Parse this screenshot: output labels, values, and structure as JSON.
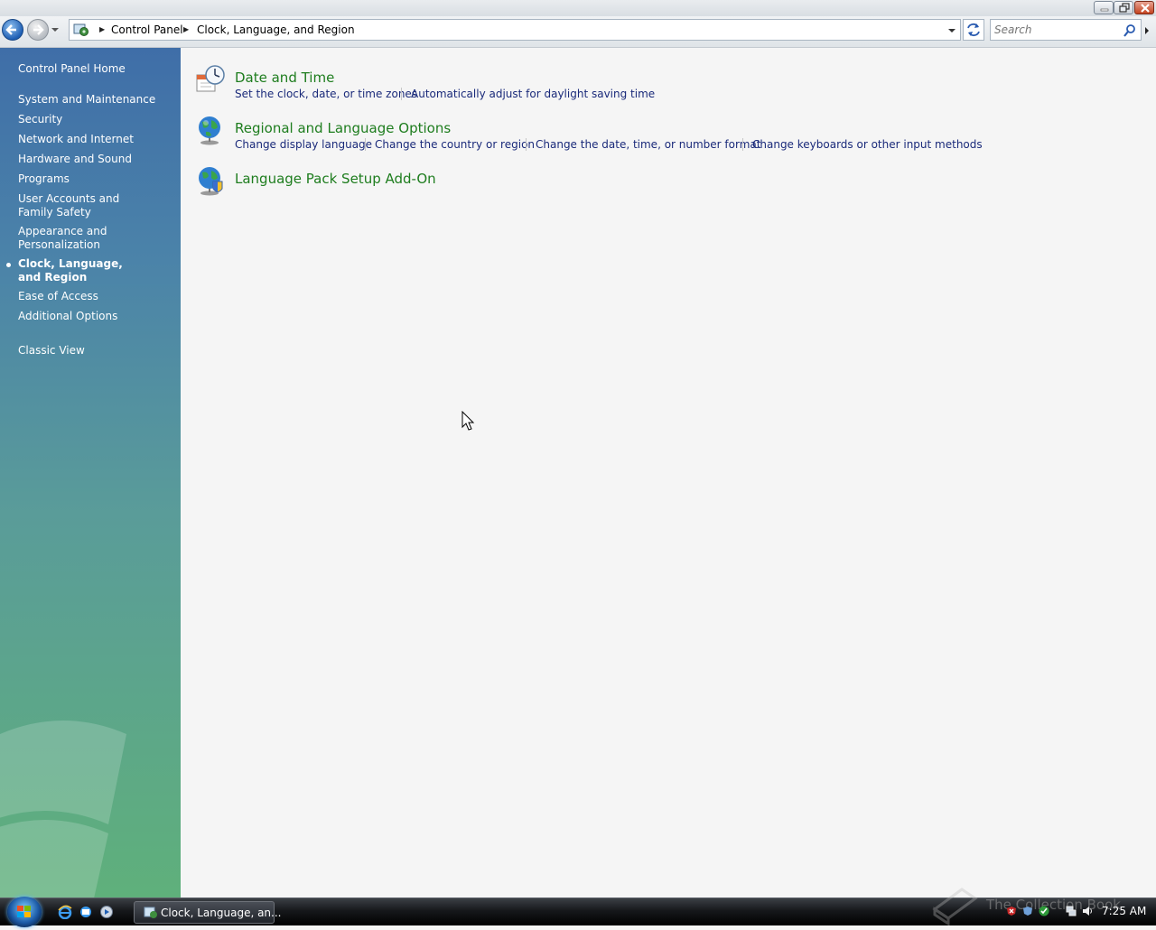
{
  "address_bar": {
    "crumbs": [
      "Control Panel",
      "Clock, Language, and Region"
    ]
  },
  "search": {
    "placeholder": "Search"
  },
  "sidebar": {
    "home": "Control Panel Home",
    "items": [
      "System and Maintenance",
      "Security",
      "Network and Internet",
      "Hardware and Sound",
      "Programs",
      "User Accounts and Family Safety",
      "Appearance and Personalization",
      "Clock, Language, and Region",
      "Ease of Access",
      "Additional Options"
    ],
    "current_item": "Clock, Language, and Region",
    "classic_view": "Classic View"
  },
  "categories": [
    {
      "title": "Date and Time",
      "icon": "clock-calendar-icon",
      "tasks": [
        "Set the clock, date, or time zones",
        "Automatically adjust for daylight saving time"
      ]
    },
    {
      "title": "Regional and Language Options",
      "icon": "globe-icon",
      "tasks": [
        "Change display language",
        "Change the country or region",
        "Change the date, time, or number format",
        "Change keyboards or other input methods"
      ]
    },
    {
      "title": "Language Pack Setup Add-On",
      "icon": "globe-shield-icon",
      "tasks": []
    }
  ],
  "taskbar": {
    "window_button": "Clock, Language, an...",
    "watermark": "The Collection Book",
    "clock": "7:25 AM"
  },
  "colors": {
    "link_green": "#1e7d1e",
    "task_link": "#1a2a7a",
    "sidebar_top": "#3f6ea8",
    "sidebar_bottom": "#5fb07b"
  }
}
